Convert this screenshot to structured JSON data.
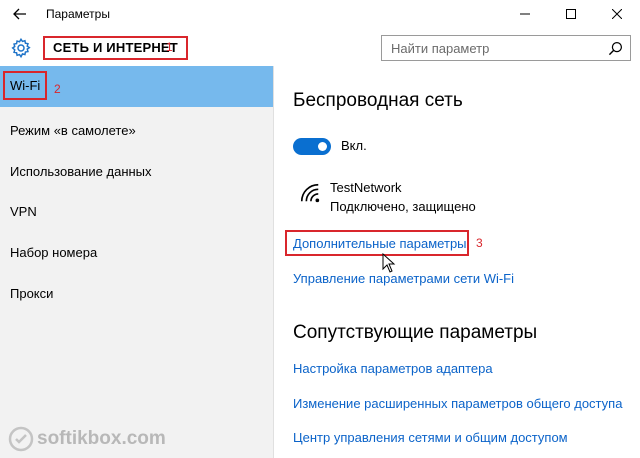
{
  "window": {
    "title": "Параметры"
  },
  "header": {
    "title": "СЕТЬ И ИНТЕРНЕТ",
    "marker": "1"
  },
  "search": {
    "placeholder": "Найти параметр"
  },
  "sidebar": {
    "items": [
      {
        "label": "Wi-Fi",
        "active": true,
        "marker": "2"
      },
      {
        "label": "Режим «в самолете»"
      },
      {
        "label": "Использование данных"
      },
      {
        "label": "VPN"
      },
      {
        "label": "Набор номера"
      },
      {
        "label": "Прокси"
      }
    ]
  },
  "main": {
    "wireless_title": "Беспроводная сеть",
    "toggle_label": "Вкл.",
    "toggle_on": true,
    "network": {
      "name": "TestNetwork",
      "status": "Подключено, защищено"
    },
    "advanced_link": "Дополнительные параметры",
    "advanced_marker": "3",
    "manage_link": "Управление параметрами сети Wi-Fi",
    "related_title": "Сопутствующие параметры",
    "related_links": [
      "Настройка параметров адаптера",
      "Изменение расширенных параметров общего доступа",
      "Центр управления сетями и общим доступом"
    ]
  },
  "watermark": {
    "text": "softikbox.com"
  },
  "colors": {
    "accent": "#0a6fd0",
    "link": "#0b63c9",
    "active_nav": "#76b9ed",
    "annotation": "#d9262c"
  }
}
